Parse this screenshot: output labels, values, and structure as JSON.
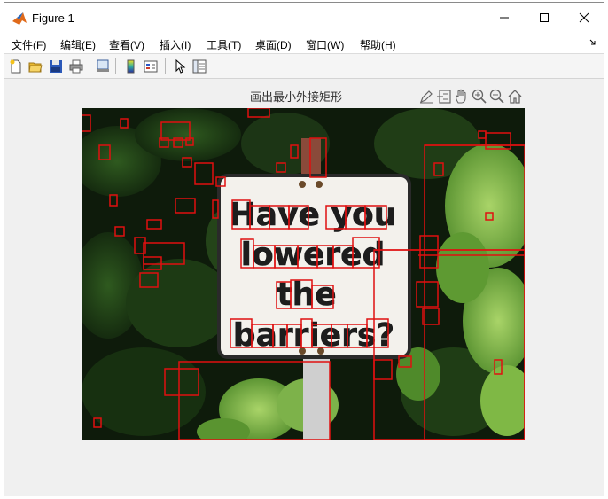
{
  "window": {
    "title": "Figure 1"
  },
  "menu": {
    "items": [
      "文件(F)",
      "编辑(E)",
      "查看(V)",
      "插入(I)",
      "工具(T)",
      "桌面(D)",
      "窗口(W)",
      "帮助(H)"
    ]
  },
  "toolbar": {
    "buttons": [
      "new-figure-icon",
      "open-file-icon",
      "save-icon",
      "print-icon",
      "link-plot-icon",
      "insert-colorbar-icon",
      "insert-legend-icon",
      "edit-plot-arrow-icon",
      "property-inspector-icon"
    ]
  },
  "axes": {
    "title": "画出最小外接矩形",
    "toolbar_buttons": [
      "brush-icon",
      "datatip-icon",
      "pan-hand-icon",
      "zoom-in-icon",
      "zoom-out-icon",
      "home-icon"
    ]
  },
  "sign": {
    "line1": "Have you",
    "line2": "lowered",
    "line3": "the",
    "line4": "barriers?"
  },
  "colors": {
    "bounding_box": "#e01010",
    "foliage_dark": "#0d1a0a",
    "foliage_light": "#6aa33a",
    "sign_face": "#f3f1ec"
  }
}
